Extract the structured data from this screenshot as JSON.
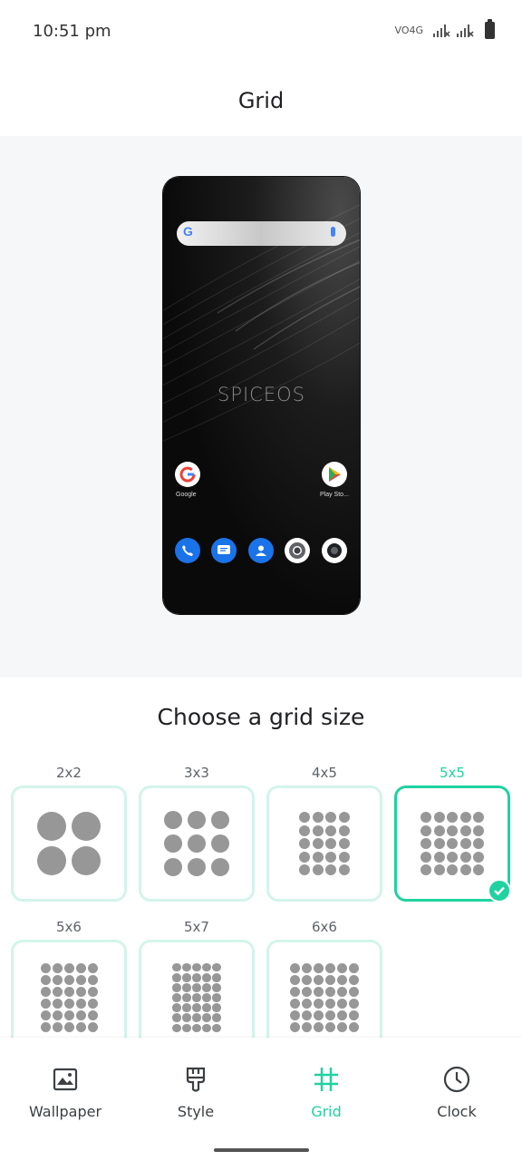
{
  "status_bar": {
    "time": "10:51 pm",
    "network": "VO4G"
  },
  "header": {
    "title": "Grid"
  },
  "preview": {
    "brand_text": "SPICEOS",
    "home_apps": [
      {
        "label": "Google"
      },
      {
        "label": "Play Sto..."
      }
    ],
    "dock_apps": [
      {
        "name": "phone-icon"
      },
      {
        "name": "messages-icon"
      },
      {
        "name": "contacts-icon"
      },
      {
        "name": "chrome-icon"
      },
      {
        "name": "camera-icon"
      }
    ]
  },
  "chooser": {
    "title": "Choose a grid size",
    "options": [
      {
        "label": "2x2",
        "cols": 2,
        "rows": 2,
        "selected": false
      },
      {
        "label": "3x3",
        "cols": 3,
        "rows": 3,
        "selected": false
      },
      {
        "label": "4x5",
        "cols": 4,
        "rows": 5,
        "selected": false
      },
      {
        "label": "5x5",
        "cols": 5,
        "rows": 5,
        "selected": true
      },
      {
        "label": "5x6",
        "cols": 5,
        "rows": 6,
        "selected": false
      },
      {
        "label": "5x7",
        "cols": 5,
        "rows": 7,
        "selected": false
      },
      {
        "label": "6x6",
        "cols": 6,
        "rows": 6,
        "selected": false
      }
    ]
  },
  "bottom_nav": {
    "items": [
      {
        "label": "Wallpaper",
        "icon": "wallpaper-icon",
        "active": false
      },
      {
        "label": "Style",
        "icon": "style-brush-icon",
        "active": false
      },
      {
        "label": "Grid",
        "icon": "grid-icon",
        "active": true
      },
      {
        "label": "Clock",
        "icon": "clock-icon",
        "active": false
      }
    ]
  },
  "colors": {
    "accent": "#1fd2a0",
    "card_border": "#d3f4eb",
    "dot": "#979797",
    "preview_bg": "#f6f7f9"
  }
}
